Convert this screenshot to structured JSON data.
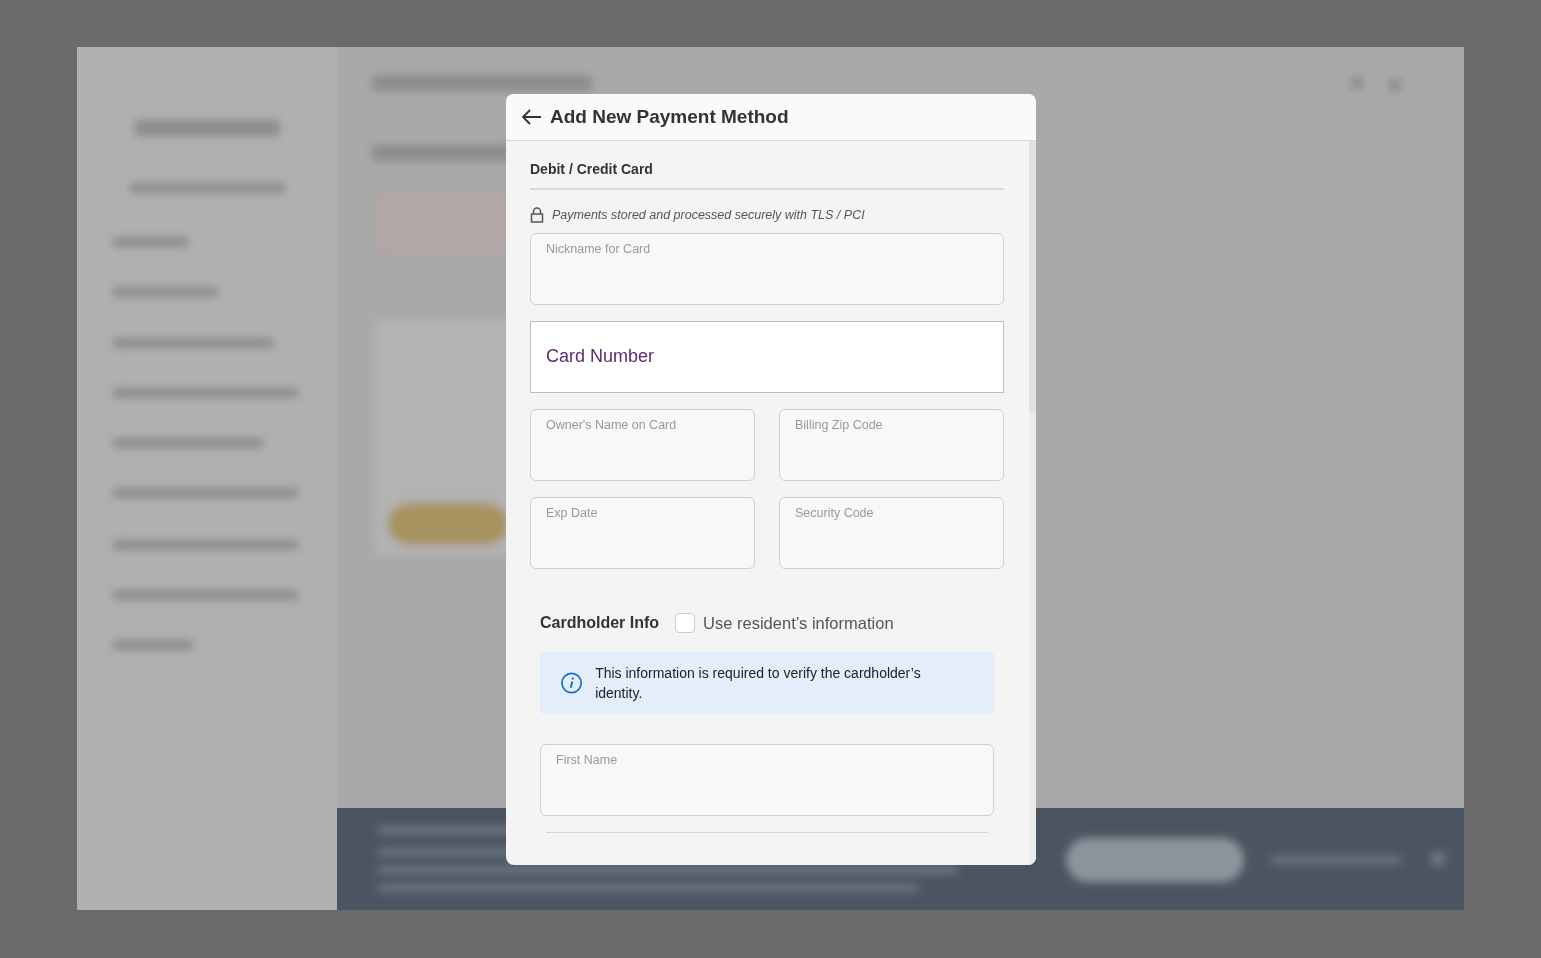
{
  "modal": {
    "title": "Add New Payment Method",
    "section_title": "Debit / Credit Card",
    "security_note": "Payments stored and processed securely with TLS / PCI",
    "card_field_rows": [
      [
        {
          "kind": "floating",
          "placeholder": "Nickname for Card"
        }
      ],
      [
        {
          "kind": "hosted",
          "placeholder": "Card Number"
        }
      ],
      [
        {
          "kind": "floating",
          "placeholder": "Owner's Name on Card"
        },
        {
          "kind": "floating",
          "placeholder": "Billing Zip Code"
        }
      ],
      [
        {
          "kind": "floating",
          "placeholder": "Exp Date"
        },
        {
          "kind": "floating",
          "placeholder": "Security Code"
        }
      ]
    ],
    "cardholder": {
      "title": "Cardholder Info",
      "checkbox": {
        "label": "Use resident’s information",
        "checked": false
      },
      "info": "This information is required to verify the cardholder’s identity.",
      "fields": [
        {
          "kind": "floating",
          "placeholder": "First Name"
        }
      ]
    }
  }
}
